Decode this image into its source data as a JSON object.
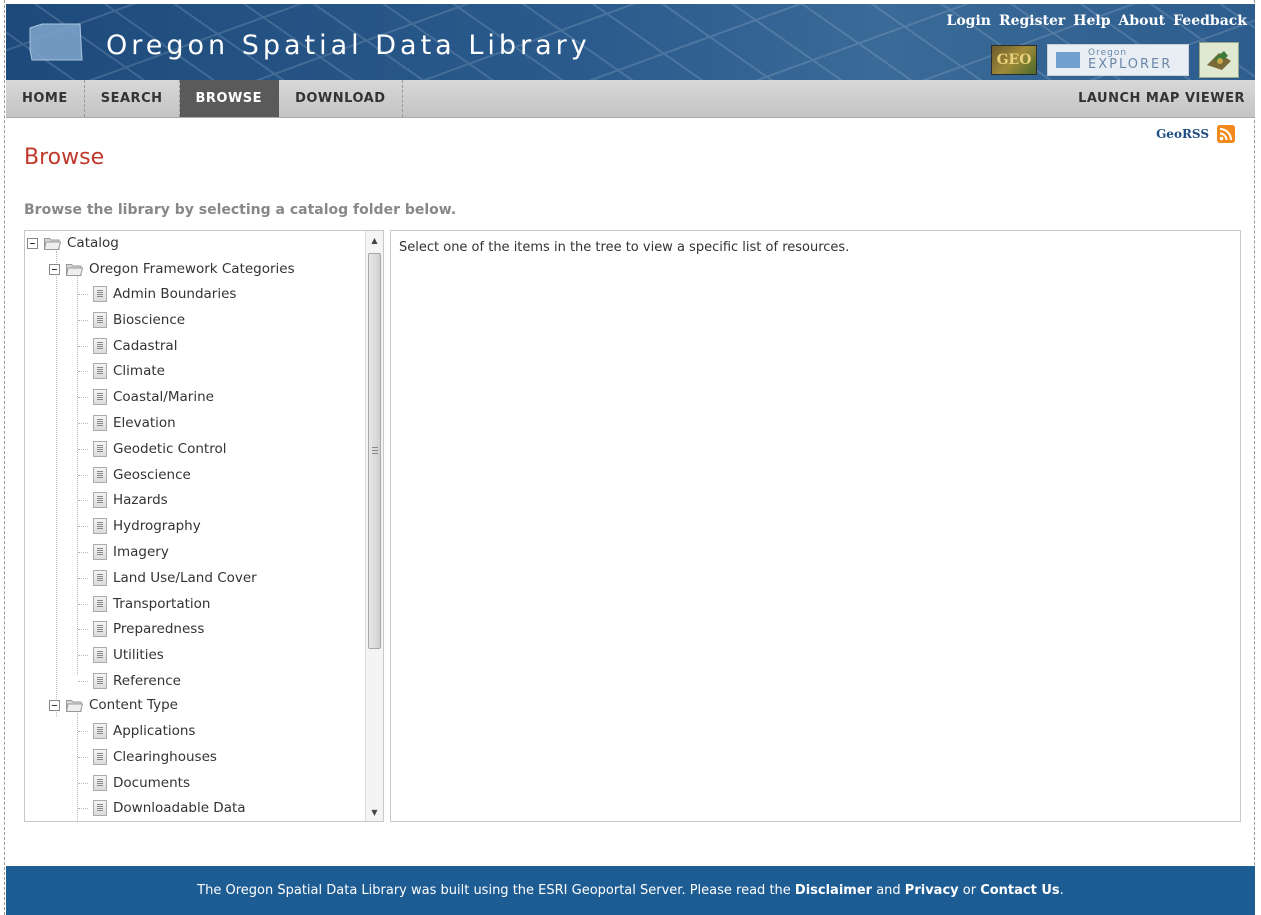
{
  "header": {
    "site_title": "Oregon Spatial Data Library",
    "links": [
      "Login",
      "Register",
      "Help",
      "About",
      "Feedback"
    ],
    "badge_geo_text": "GEO",
    "badge_explorer_small": "Oregon",
    "badge_explorer_big": "EXPLORER"
  },
  "nav": {
    "tabs": [
      "HOME",
      "SEARCH",
      "BROWSE",
      "DOWNLOAD"
    ],
    "active_tab": "BROWSE",
    "right_link": "LAUNCH MAP VIEWER"
  },
  "georss": {
    "label": "GeoRSS"
  },
  "page": {
    "title": "Browse",
    "subtitle": "Browse the library by selecting a catalog folder below."
  },
  "tree": {
    "root": "Catalog",
    "groups": [
      {
        "label": "Oregon Framework Categories",
        "items": [
          "Admin Boundaries",
          "Bioscience",
          "Cadastral",
          "Climate",
          "Coastal/Marine",
          "Elevation",
          "Geodetic Control",
          "Geoscience",
          "Hazards",
          "Hydrography",
          "Imagery",
          "Land Use/Land Cover",
          "Transportation",
          "Preparedness",
          "Utilities",
          "Reference"
        ]
      },
      {
        "label": "Content Type",
        "items": [
          "Applications",
          "Clearinghouses",
          "Documents",
          "Downloadable Data"
        ]
      }
    ]
  },
  "results": {
    "message": "Select one of the items in the tree to view a specific list of resources."
  },
  "footer": {
    "prefix": "The Oregon Spatial Data Library was built using the ESRI Geoportal Server. Please read the ",
    "disclaimer": "Disclaimer",
    "and": " and ",
    "privacy": "Privacy",
    "or": " or ",
    "contact": "Contact Us",
    "suffix": "."
  },
  "colors": {
    "banner": "#2a5a8c",
    "title_red": "#c0392b",
    "footer_blue": "#1e5c94",
    "active_tab": "#5a5a5a",
    "rss_orange": "#f18a1b"
  }
}
